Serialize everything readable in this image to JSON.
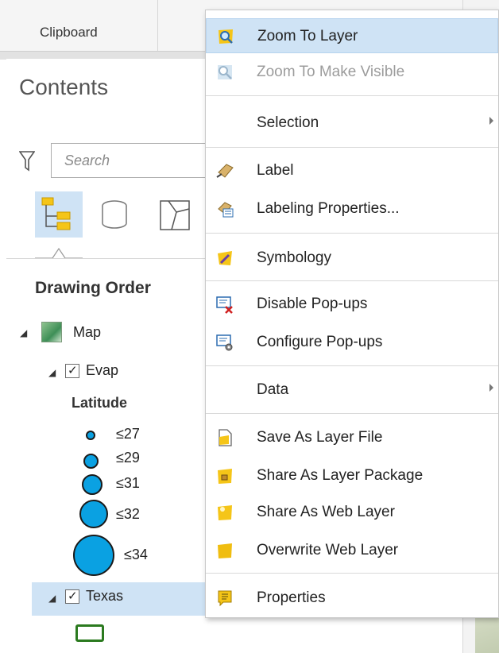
{
  "ribbon": {
    "group_label": "Clipboard"
  },
  "contents_pane": {
    "title": "Contents",
    "search_placeholder": "Search",
    "view_heading": "Drawing Order",
    "tree": {
      "map": {
        "label": "Map"
      },
      "evap": {
        "label": "Evap",
        "checked": true
      },
      "legend_heading": "Latitude",
      "legend": [
        {
          "label": "≤27"
        },
        {
          "label": "≤29"
        },
        {
          "label": "≤31"
        },
        {
          "label": "≤32"
        },
        {
          "label": "≤34"
        }
      ],
      "texas": {
        "label": "Texas",
        "checked": true
      }
    },
    "colors": {
      "selection": "#cfe3f5",
      "symbol_fill": "#0aa1e2",
      "polygon_outline": "#2b7a1f"
    }
  },
  "context_menu": {
    "items": [
      {
        "label": "Zoom To Layer",
        "icon": "zoom-to-layer-icon",
        "state": "hover"
      },
      {
        "label": "Zoom To Make Visible",
        "icon": "zoom-to-visible-icon",
        "state": "disabled"
      },
      {
        "label": "Selection",
        "icon": "",
        "submenu": true
      },
      {
        "label": "Label",
        "icon": "label-icon"
      },
      {
        "label": "Labeling Properties...",
        "icon": "labeling-properties-icon"
      },
      {
        "label": "Symbology",
        "icon": "symbology-icon"
      },
      {
        "label": "Disable Pop-ups",
        "icon": "disable-popups-icon"
      },
      {
        "label": "Configure Pop-ups",
        "icon": "configure-popups-icon"
      },
      {
        "label": "Data",
        "icon": "",
        "submenu": true
      },
      {
        "label": "Save As Layer File",
        "icon": "save-layer-file-icon"
      },
      {
        "label": "Share As Layer Package",
        "icon": "share-layer-package-icon"
      },
      {
        "label": "Share As Web Layer",
        "icon": "share-web-layer-icon"
      },
      {
        "label": "Overwrite Web Layer",
        "icon": "overwrite-web-layer-icon"
      },
      {
        "label": "Properties",
        "icon": "properties-icon"
      }
    ]
  }
}
